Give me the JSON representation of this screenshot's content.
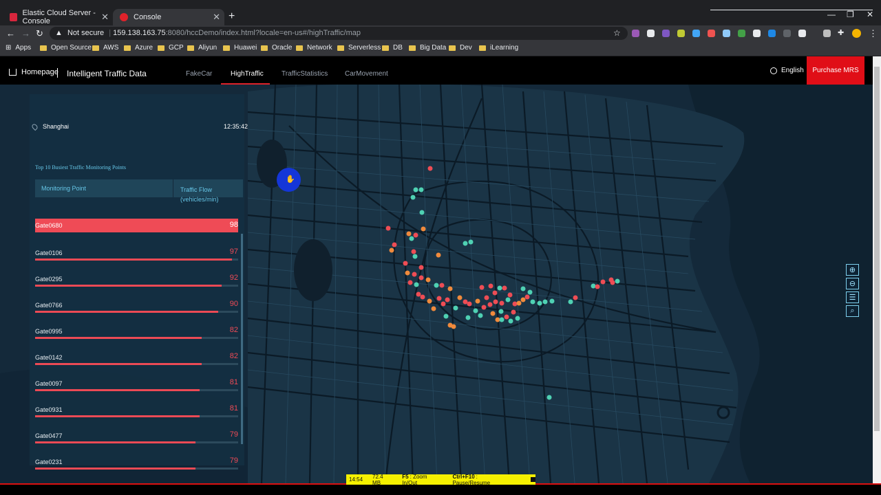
{
  "browser": {
    "tabs": [
      {
        "title": "Elastic Cloud Server - Console",
        "active": false
      },
      {
        "title": "Console",
        "active": true
      }
    ],
    "security_label": "Not secure",
    "url_host": "159.138.163.75",
    "url_rest": ":8080/hccDemo/index.html?locale=en-us#/highTraffic/map",
    "bookmarks": [
      "Apps",
      "Open Source",
      "AWS",
      "Azure",
      "GCP",
      "Aliyun",
      "Huawei",
      "Oracle",
      "Network",
      "Serverless",
      "DB",
      "Big Data",
      "Dev",
      "iLearning"
    ]
  },
  "header": {
    "home_label": "Homepage",
    "title": "Intelligent Traffic Data",
    "nav": [
      "FakeCar",
      "HighTraffic",
      "TrafficStatistics",
      "CarMovement"
    ],
    "active_nav": "HighTraffic",
    "language": "English",
    "purchase_label": "Purchase MRS"
  },
  "panel": {
    "city": "Shanghai",
    "time": "12:35:42",
    "title": "Top 10 Busiest Traffic Monitoring Points",
    "col_point": "Monitoring Point",
    "col_flow_line1": "Traffic Flow",
    "col_flow_line2": "(vehicles/min)",
    "max_value": 100,
    "rows": [
      {
        "name": "Gate0680",
        "value": 98
      },
      {
        "name": "Gate0106",
        "value": 97
      },
      {
        "name": "Gate0295",
        "value": 92
      },
      {
        "name": "Gate0766",
        "value": 90
      },
      {
        "name": "Gate0995",
        "value": 82
      },
      {
        "name": "Gate0142",
        "value": 82
      },
      {
        "name": "Gate0097",
        "value": 81
      },
      {
        "name": "Gate0931",
        "value": 81
      },
      {
        "name": "Gate0477",
        "value": 79
      },
      {
        "name": "Gate0231",
        "value": 79
      }
    ]
  },
  "colors": {
    "high": "#ee4d55",
    "medium": "#f08a3c",
    "low": "#4fd1b3",
    "map_bg": "#14293a",
    "accent": "#e00e17"
  },
  "recorder": {
    "time": "14:54",
    "size": "72.4 MB",
    "zoom_key": "F5",
    "zoom_text": ": Zoom In/Out",
    "pause_key": "Ctrl+F10",
    "pause_text": ": Pause/Resume"
  }
}
